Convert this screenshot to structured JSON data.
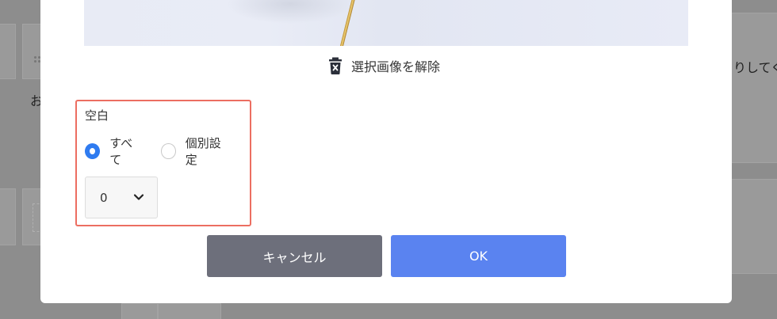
{
  "background": {
    "partial_left_text": "お",
    "partial_right_text": "りしてくた"
  },
  "modal": {
    "clear_image_label": "選択画像を解除",
    "spacing": {
      "title": "空白",
      "options": [
        {
          "label": "すべて",
          "selected": true
        },
        {
          "label": "個別設定",
          "selected": false
        }
      ],
      "select_value": "0"
    },
    "buttons": {
      "cancel": "キャンセル",
      "ok": "OK"
    }
  },
  "colors": {
    "accent": "#2f7bf0",
    "ok_button": "#5a83f0",
    "cancel_button": "#6d6f7b",
    "highlight_border": "#ec6e61"
  },
  "icons": {
    "trash": "trash-icon",
    "chevron": "chevron-down-icon"
  }
}
